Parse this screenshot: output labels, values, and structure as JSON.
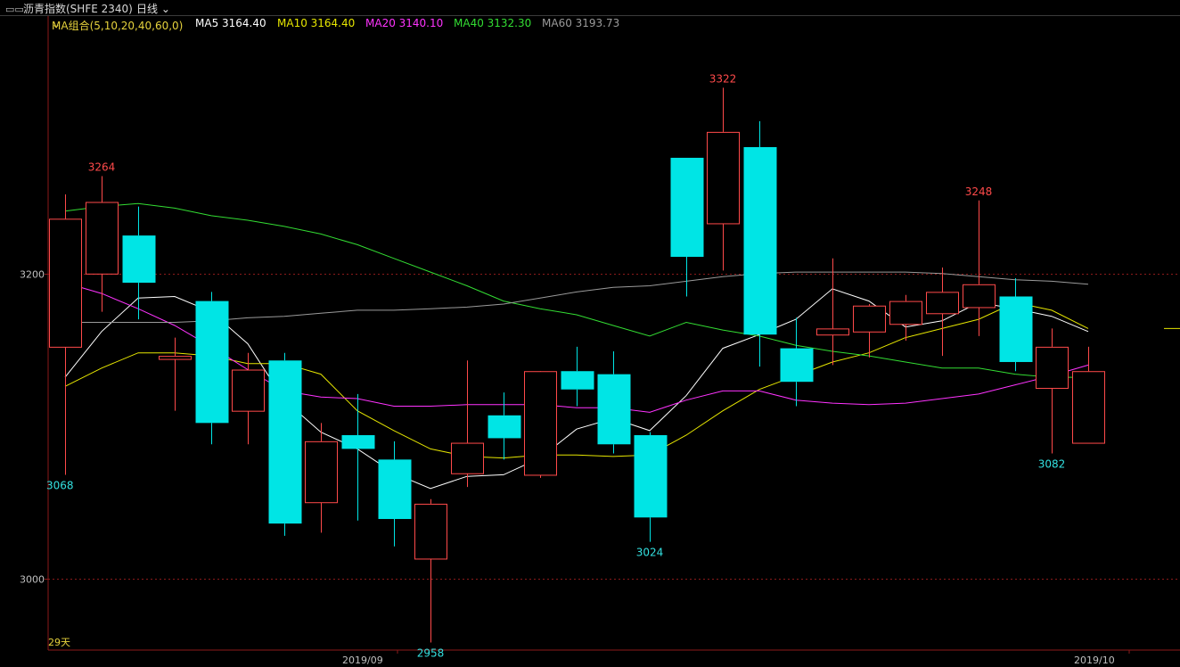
{
  "header": {
    "title": "沥青指数(SHFE 2340)",
    "period": "日线",
    "icon": "chart-window-icon"
  },
  "ma_legend": [
    {
      "label": "MA组合(5,10,20,40,60,0)",
      "color": "#e6d23c"
    },
    {
      "label": "MA5 3164.40",
      "color": "#ffffff"
    },
    {
      "label": "MA10 3164.40",
      "color": "#e6e600"
    },
    {
      "label": "MA20 3140.10",
      "color": "#ff33ff"
    },
    {
      "label": "MA40 3132.30",
      "color": "#33dd33"
    },
    {
      "label": "MA60 3193.73",
      "color": "#9a9a9a"
    }
  ],
  "colors": {
    "up": "#ff4a4a",
    "down": "#00e5e5",
    "grid": "#8b1a1a",
    "axis": "#8b1a1a",
    "high_label": "#ff4a4a",
    "low_label": "#33e0e0",
    "days_label": "#e6d23c"
  },
  "chart_data": {
    "type": "candlestick",
    "y_ticks": [
      3000,
      3200
    ],
    "ylim": [
      2953,
      3369
    ],
    "x_labels": [
      "2019/09",
      "2019/10"
    ],
    "days_label": "29天",
    "annotations": [
      {
        "text": "3264",
        "index": 1,
        "value": 3264,
        "kind": "high"
      },
      {
        "text": "3322",
        "index": 18,
        "value": 3322,
        "kind": "high"
      },
      {
        "text": "3248",
        "index": 25,
        "value": 3248,
        "kind": "high"
      },
      {
        "text": "3068",
        "index": 0,
        "value": 3068,
        "kind": "low"
      },
      {
        "text": "3024",
        "index": 16,
        "value": 3024,
        "kind": "low"
      },
      {
        "text": "2958",
        "index": 10,
        "value": 2958,
        "kind": "low"
      },
      {
        "text": "3082",
        "index": 27,
        "value": 3082,
        "kind": "low"
      }
    ],
    "candles": [
      {
        "open": 3152,
        "high": 3252,
        "low": 3068,
        "close": 3236
      },
      {
        "open": 3200,
        "high": 3264,
        "low": 3175,
        "close": 3247
      },
      {
        "open": 3225,
        "high": 3244,
        "low": 3170,
        "close": 3194
      },
      {
        "open": 3144,
        "high": 3158,
        "low": 3110,
        "close": 3146
      },
      {
        "open": 3182,
        "high": 3188,
        "low": 3088,
        "close": 3102
      },
      {
        "open": 3110,
        "high": 3148,
        "low": 3088,
        "close": 3137
      },
      {
        "open": 3143,
        "high": 3148,
        "low": 3028,
        "close": 3036
      },
      {
        "open": 3050,
        "high": 3102,
        "low": 3030,
        "close": 3090
      },
      {
        "open": 3094,
        "high": 3121,
        "low": 3038,
        "close": 3085
      },
      {
        "open": 3078,
        "high": 3090,
        "low": 3021,
        "close": 3039
      },
      {
        "open": 3013,
        "high": 3052,
        "low": 2958,
        "close": 3049
      },
      {
        "open": 3069,
        "high": 3143,
        "low": 3060,
        "close": 3089
      },
      {
        "open": 3107,
        "high": 3122,
        "low": 3078,
        "close": 3092
      },
      {
        "open": 3068,
        "high": 3135,
        "low": 3066,
        "close": 3136
      },
      {
        "open": 3136,
        "high": 3152,
        "low": 3113,
        "close": 3124
      },
      {
        "open": 3134,
        "high": 3149,
        "low": 3082,
        "close": 3088
      },
      {
        "open": 3094,
        "high": 3096,
        "low": 3024,
        "close": 3040
      },
      {
        "open": 3276,
        "high": 3276,
        "low": 3185,
        "close": 3211
      },
      {
        "open": 3233,
        "high": 3322,
        "low": 3202,
        "close": 3293
      },
      {
        "open": 3283,
        "high": 3300,
        "low": 3139,
        "close": 3160
      },
      {
        "open": 3151,
        "high": 3171,
        "low": 3113,
        "close": 3129
      },
      {
        "open": 3160,
        "high": 3210,
        "low": 3140,
        "close": 3164
      },
      {
        "open": 3162,
        "high": 3180,
        "low": 3145,
        "close": 3179
      },
      {
        "open": 3167,
        "high": 3186,
        "low": 3156,
        "close": 3182
      },
      {
        "open": 3174,
        "high": 3204,
        "low": 3146,
        "close": 3188
      },
      {
        "open": 3178,
        "high": 3248,
        "low": 3159,
        "close": 3193
      },
      {
        "open": 3185,
        "high": 3197,
        "low": 3136,
        "close": 3142
      },
      {
        "open": 3125,
        "high": 3164,
        "low": 3082,
        "close": 3152
      },
      {
        "open": 3089,
        "high": 3152,
        "low": 3089,
        "close": 3136
      }
    ],
    "series": [
      {
        "name": "MA5",
        "color": "#ffffff",
        "values": [
          3132,
          3162,
          3184,
          3185,
          3175,
          3154,
          3117,
          3096,
          3085,
          3069,
          3059,
          3067,
          3068,
          3079,
          3098,
          3105,
          3097,
          3120,
          3151,
          3160,
          3170,
          3190,
          3182,
          3165,
          3169,
          3181,
          3177,
          3172,
          3162
        ]
      },
      {
        "name": "MA10",
        "color": "#e6e600",
        "values": [
          3126,
          3138,
          3148,
          3148,
          3146,
          3141,
          3141,
          3134,
          3110,
          3097,
          3085,
          3080,
          3079,
          3081,
          3081,
          3080,
          3081,
          3094,
          3110,
          3124,
          3133,
          3142,
          3148,
          3158,
          3164,
          3170,
          3181,
          3176,
          3164
        ]
      },
      {
        "name": "MA20",
        "color": "#ff33ff",
        "values": [
          3194,
          3187,
          3177,
          3166,
          3152,
          3137,
          3123,
          3119,
          3118,
          3113,
          3113,
          3114,
          3114,
          3114,
          3112,
          3112,
          3109,
          3117,
          3123,
          3123,
          3117,
          3115,
          3114,
          3115,
          3118,
          3121,
          3127,
          3133,
          3140
        ]
      },
      {
        "name": "MA40",
        "color": "#33dd33",
        "values": [
          3241,
          3244,
          3246,
          3243,
          3238,
          3235,
          3231,
          3226,
          3219,
          3210,
          3201,
          3192,
          3182,
          3177,
          3173,
          3166,
          3159,
          3168,
          3163,
          3159,
          3153,
          3149,
          3146,
          3142,
          3138,
          3138,
          3134,
          3132,
          3132
        ]
      },
      {
        "name": "MA60",
        "color": "#9a9a9a",
        "values": [
          3168,
          3168,
          3168,
          3168,
          3169,
          3171,
          3172,
          3174,
          3176,
          3176,
          3177,
          3178,
          3180,
          3184,
          3188,
          3191,
          3192,
          3195,
          3198,
          3200,
          3201,
          3201,
          3201,
          3201,
          3200,
          3198,
          3196,
          3195,
          3193
        ]
      }
    ]
  }
}
